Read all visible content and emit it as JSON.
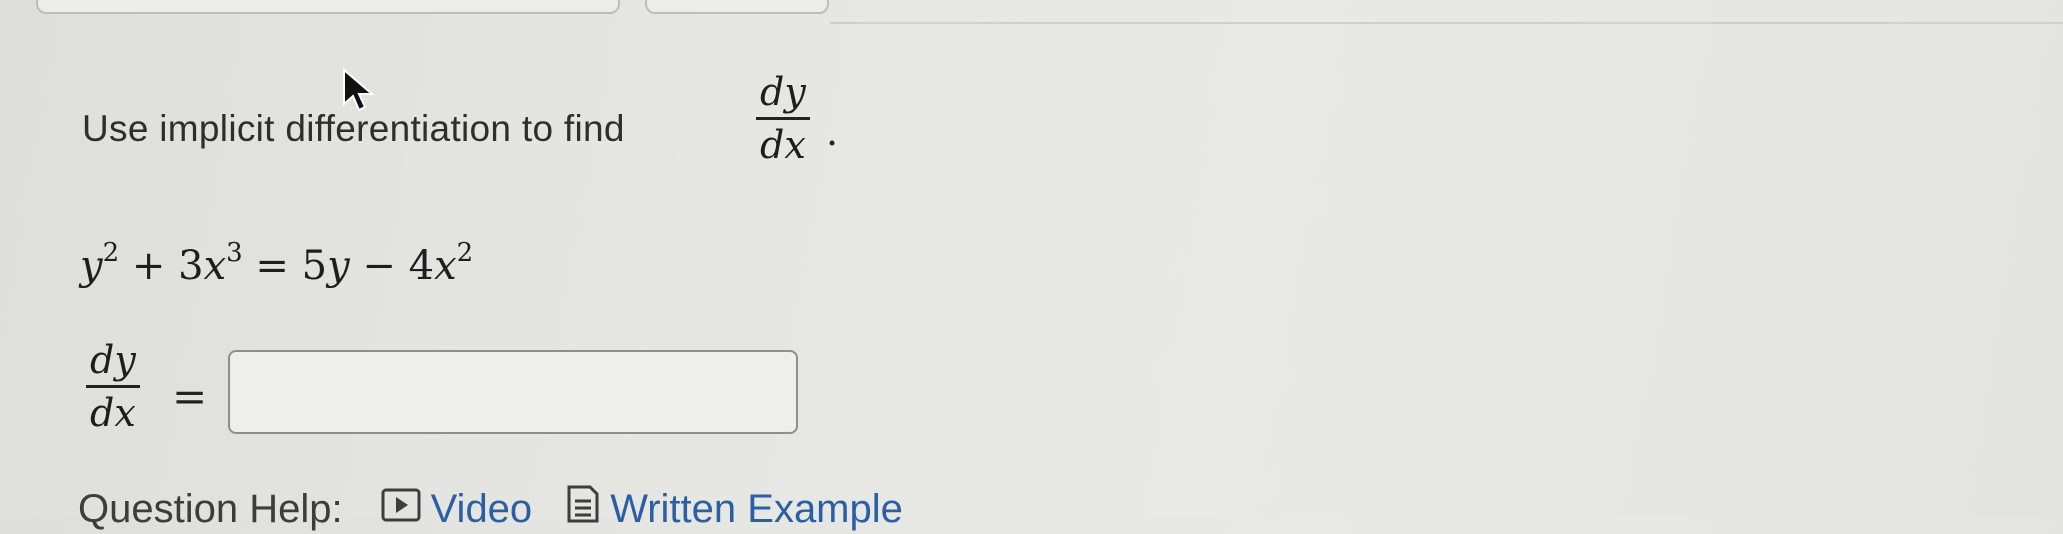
{
  "prompt": {
    "text": "Use implicit differentiation to find",
    "derivative_numerator": "dy",
    "derivative_denominator": "dx",
    "period": "."
  },
  "equation": {
    "lhs_var": "y",
    "lhs_exp": "2",
    "plus": "+",
    "term2_coef": "3",
    "term2_var": "x",
    "term2_exp": "3",
    "equals": "=",
    "rhs_coef": "5",
    "rhs_var": "y",
    "minus": "−",
    "rhs_term2_coef": "4",
    "rhs_term2_var": "x",
    "rhs_term2_exp": "2"
  },
  "answer": {
    "lhs_numerator": "dy",
    "lhs_denominator": "dx",
    "equals": "=",
    "value": ""
  },
  "help": {
    "label": "Question Help:",
    "video_label": "Video",
    "written_example_label": "Written Example"
  },
  "icons": {
    "video": "play-icon",
    "written_example": "document-icon",
    "cursor": "mouse-pointer-icon"
  },
  "colors": {
    "link": "#2a5fa6",
    "background": "#e6e6e2",
    "box_border": "#8e8e8a"
  }
}
